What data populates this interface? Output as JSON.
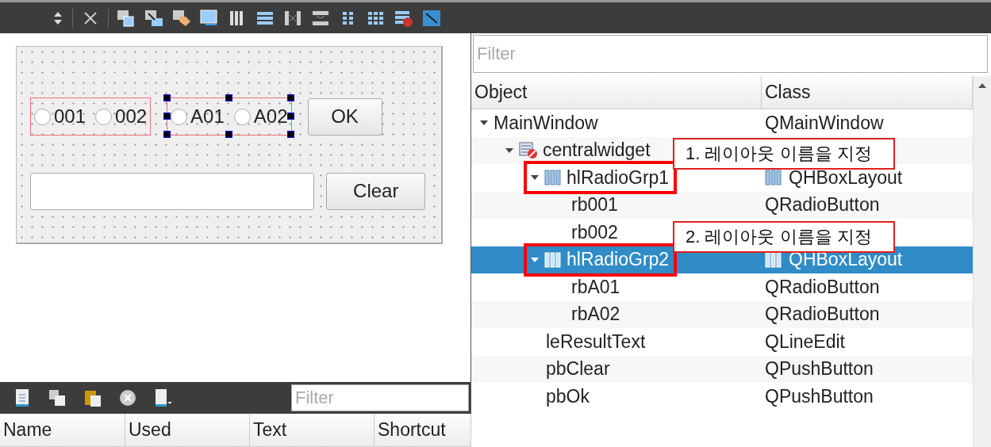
{
  "form": {
    "radio_groups": [
      {
        "selected": false,
        "options": [
          {
            "label": "001",
            "checked": false
          },
          {
            "label": "002",
            "checked": false
          }
        ]
      },
      {
        "selected": true,
        "options": [
          {
            "label": "A01",
            "checked": false
          },
          {
            "label": "A02",
            "checked": false
          }
        ]
      }
    ],
    "ok_button": "OK",
    "clear_button": "Clear"
  },
  "action_editor": {
    "filter": {
      "placeholder": "Filter"
    },
    "columns": [
      "Name",
      "Used",
      "Text",
      "Shortcut"
    ]
  },
  "object_inspector": {
    "filter": {
      "placeholder": "Filter"
    },
    "columns": [
      "Object",
      "Class"
    ],
    "tree": [
      {
        "object": "MainWindow",
        "class": "QMainWindow",
        "expanded": true,
        "selected": false,
        "highlighted": false,
        "children": [
          {
            "object": "centralwidget",
            "kind": "widget",
            "expanded": true,
            "selected": false,
            "highlighted": false,
            "children": [
              {
                "object": "hlRadioGrp1",
                "kind": "layout",
                "class": "QHBoxLayout",
                "expanded": true,
                "selected": false,
                "highlighted": true,
                "children": [
                  {
                    "object": "rb001",
                    "class": "QRadioButton",
                    "selected": false,
                    "highlighted": false
                  },
                  {
                    "object": "rb002",
                    "selected": false,
                    "highlighted": false
                  }
                ]
              },
              {
                "object": "hlRadioGrp2",
                "kind": "layout",
                "class": "QHBoxLayout",
                "expanded": true,
                "selected": true,
                "highlighted": true,
                "children": [
                  {
                    "object": "rbA01",
                    "class": "QRadioButton",
                    "selected": false,
                    "highlighted": false
                  },
                  {
                    "object": "rbA02",
                    "class": "QRadioButton",
                    "selected": false,
                    "highlighted": false
                  }
                ]
              },
              {
                "object": "leResultText",
                "class": "QLineEdit",
                "selected": false,
                "highlighted": false
              },
              {
                "object": "pbClear",
                "class": "QPushButton",
                "selected": false,
                "highlighted": false
              },
              {
                "object": "pbOk",
                "class": "QPushButton",
                "selected": false,
                "highlighted": false
              }
            ]
          }
        ]
      }
    ]
  },
  "callouts": [
    {
      "text": "1. 레이아웃 이름을 지정"
    },
    {
      "text": "2. 레이아웃 이름을 지정"
    }
  ]
}
